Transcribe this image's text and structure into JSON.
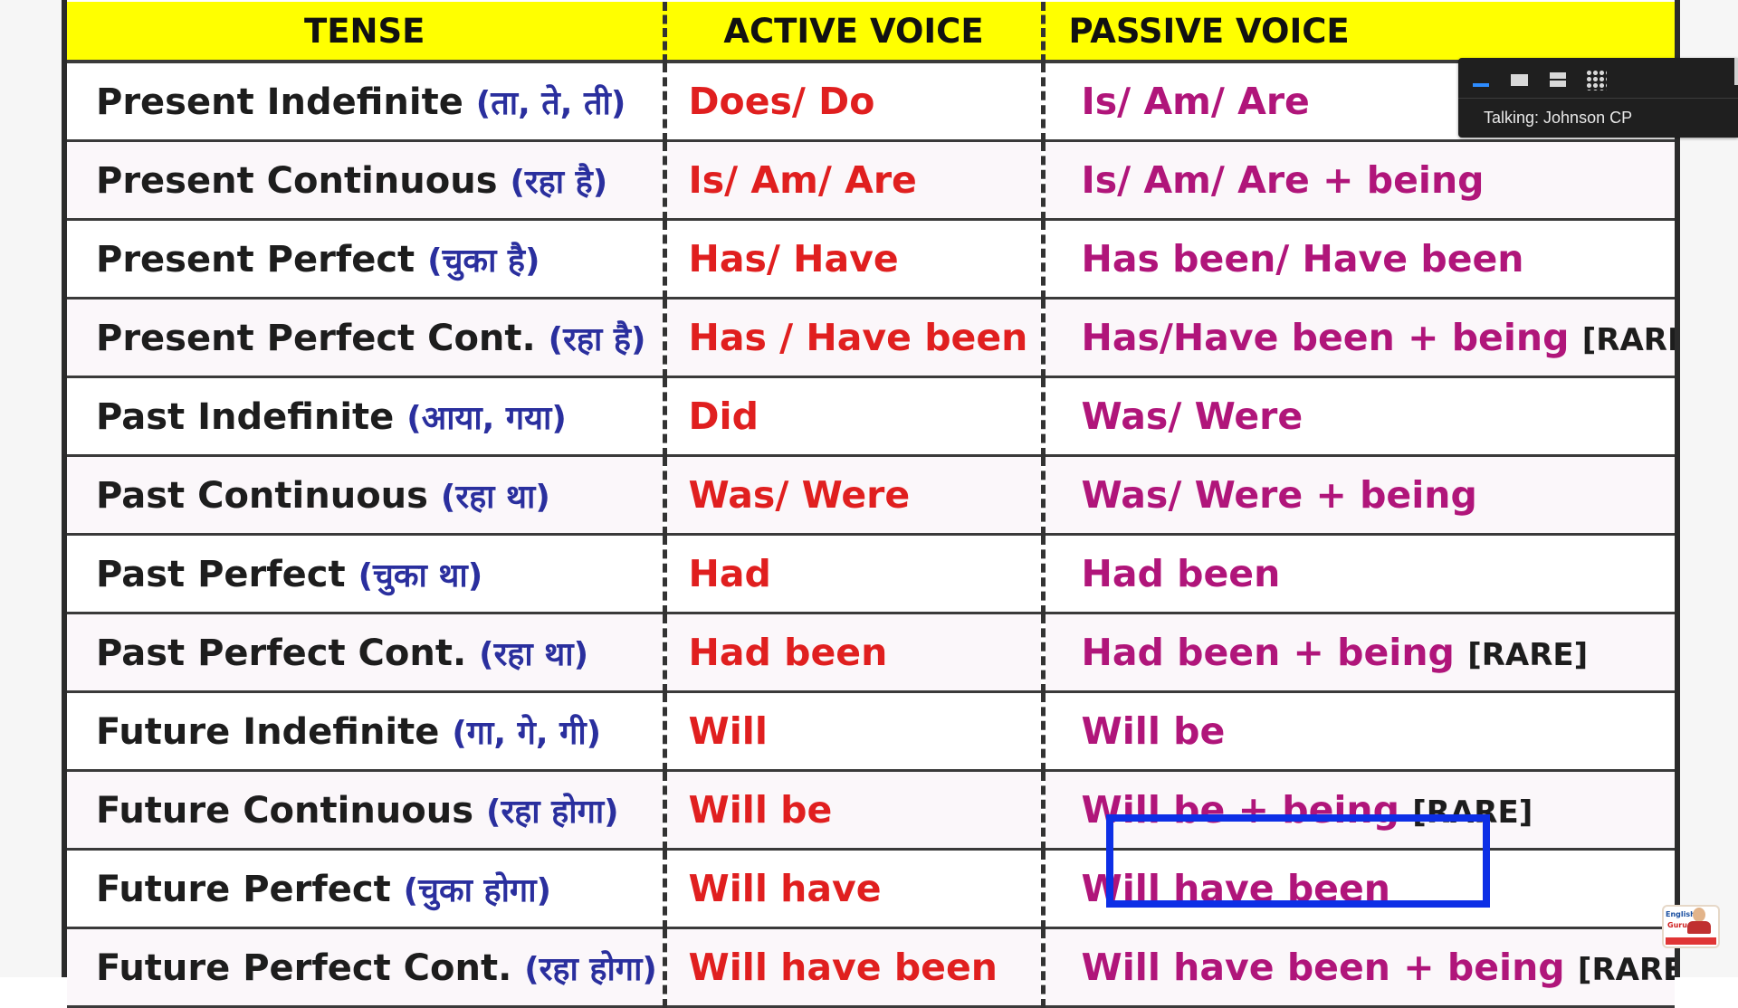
{
  "table": {
    "headers": [
      "TENSE",
      "ACTIVE VOICE",
      "PASSIVE VOICE"
    ],
    "rows": [
      {
        "tense": "Present Indefinite",
        "hindi": "(ता, ते, ती)",
        "active": "Does/ Do",
        "passive": "Is/ Am/ Are",
        "rare": ""
      },
      {
        "tense": "Present Continuous",
        "hindi": "(रहा है)",
        "active": "Is/ Am/ Are",
        "passive": "Is/ Am/ Are + being",
        "rare": ""
      },
      {
        "tense": "Present Perfect",
        "hindi": "(चुका है)",
        "active": "Has/ Have",
        "passive": "Has been/ Have been",
        "rare": ""
      },
      {
        "tense": "Present Perfect Cont.",
        "hindi": "(रहा है)",
        "active": "Has / Have been",
        "passive": "Has/Have been + being",
        "rare": "[RARE]"
      },
      {
        "tense": "Past Indefinite",
        "hindi": "(आया, गया)",
        "active": "Did",
        "passive": "Was/ Were",
        "rare": ""
      },
      {
        "tense": "Past Continuous",
        "hindi": "(रहा था)",
        "active": "Was/ Were",
        "passive": "Was/ Were + being",
        "rare": ""
      },
      {
        "tense": "Past Perfect",
        "hindi": "(चुका था)",
        "active": "Had",
        "passive": "Had been",
        "rare": ""
      },
      {
        "tense": "Past Perfect Cont.",
        "hindi": "(रहा था)",
        "active": "Had been",
        "passive": "Had been + being",
        "rare": "[RARE]"
      },
      {
        "tense": "Future Indefinite",
        "hindi": "(गा, गे, गी)",
        "active": "Will",
        "passive": "Will be",
        "rare": ""
      },
      {
        "tense": "Future Continuous",
        "hindi": "(रहा होगा)",
        "active": "Will be",
        "passive": "Will be + being",
        "rare": "[RARE]"
      },
      {
        "tense": "Future Perfect",
        "hindi": "(चुका होगा)",
        "active": "Will have",
        "passive": "Will have been",
        "rare": ""
      },
      {
        "tense": "Future Perfect Cont.",
        "hindi": "(रहा होगा)",
        "active": "Will have been",
        "passive": "Will have been + being",
        "rare": "[RARE]"
      }
    ]
  },
  "highlight": {
    "row_index": 10,
    "column": "passive",
    "color": "#0d2fe6"
  },
  "zoom_bar": {
    "talking": "Talking: Johnson CP",
    "icons": [
      "minimize-icon",
      "speaker-view-icon",
      "filmstrip-view-icon",
      "gallery-view-icon"
    ]
  },
  "colors": {
    "header_bg": "#ffff00",
    "tense_text": "#1d1d1d",
    "hindi_text": "#2a2f9e",
    "active_text": "#e01f1f",
    "passive_text": "#b0157a"
  },
  "logo": {
    "line1": "English",
    "line2": "Guru"
  }
}
